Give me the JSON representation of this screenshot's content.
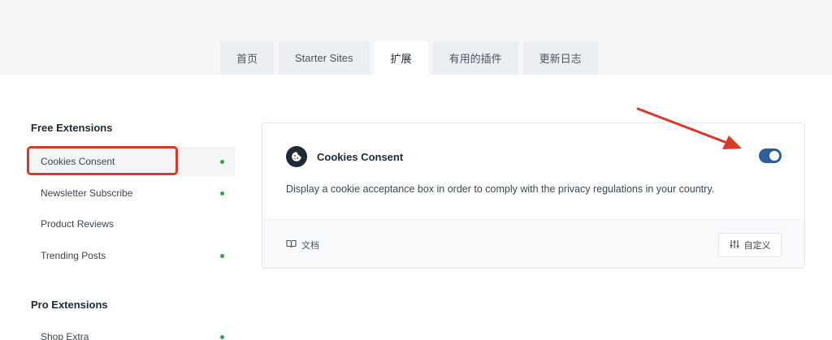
{
  "tabs": [
    {
      "label": "首页",
      "active": false
    },
    {
      "label": "Starter Sites",
      "active": false
    },
    {
      "label": "扩展",
      "active": true
    },
    {
      "label": "有用的插件",
      "active": false
    },
    {
      "label": "更新日志",
      "active": false
    }
  ],
  "sidebar": {
    "free_heading": "Free Extensions",
    "free_items": [
      {
        "label": "Cookies Consent",
        "enabled": true,
        "selected": true
      },
      {
        "label": "Newsletter Subscribe",
        "enabled": true,
        "selected": false
      },
      {
        "label": "Product Reviews",
        "enabled": false,
        "selected": false
      },
      {
        "label": "Trending Posts",
        "enabled": true,
        "selected": false
      }
    ],
    "pro_heading": "Pro Extensions",
    "pro_items": [
      {
        "label": "Shop Extra",
        "enabled": true
      }
    ]
  },
  "card": {
    "title": "Cookies Consent",
    "icon": "cookie-icon",
    "description": "Display a cookie acceptance box in order to comply with the privacy regulations in your country.",
    "toggle_on": true,
    "docs_label": "文档",
    "docs_icon": "book-icon",
    "customize_label": "自定义",
    "customize_icon": "sliders-icon"
  },
  "annotation": {
    "highlight_color": "#d63a2a",
    "arrow_color": "#d63a2a"
  },
  "colors": {
    "accent": "#2c5f95",
    "status_green": "#31a24c"
  }
}
